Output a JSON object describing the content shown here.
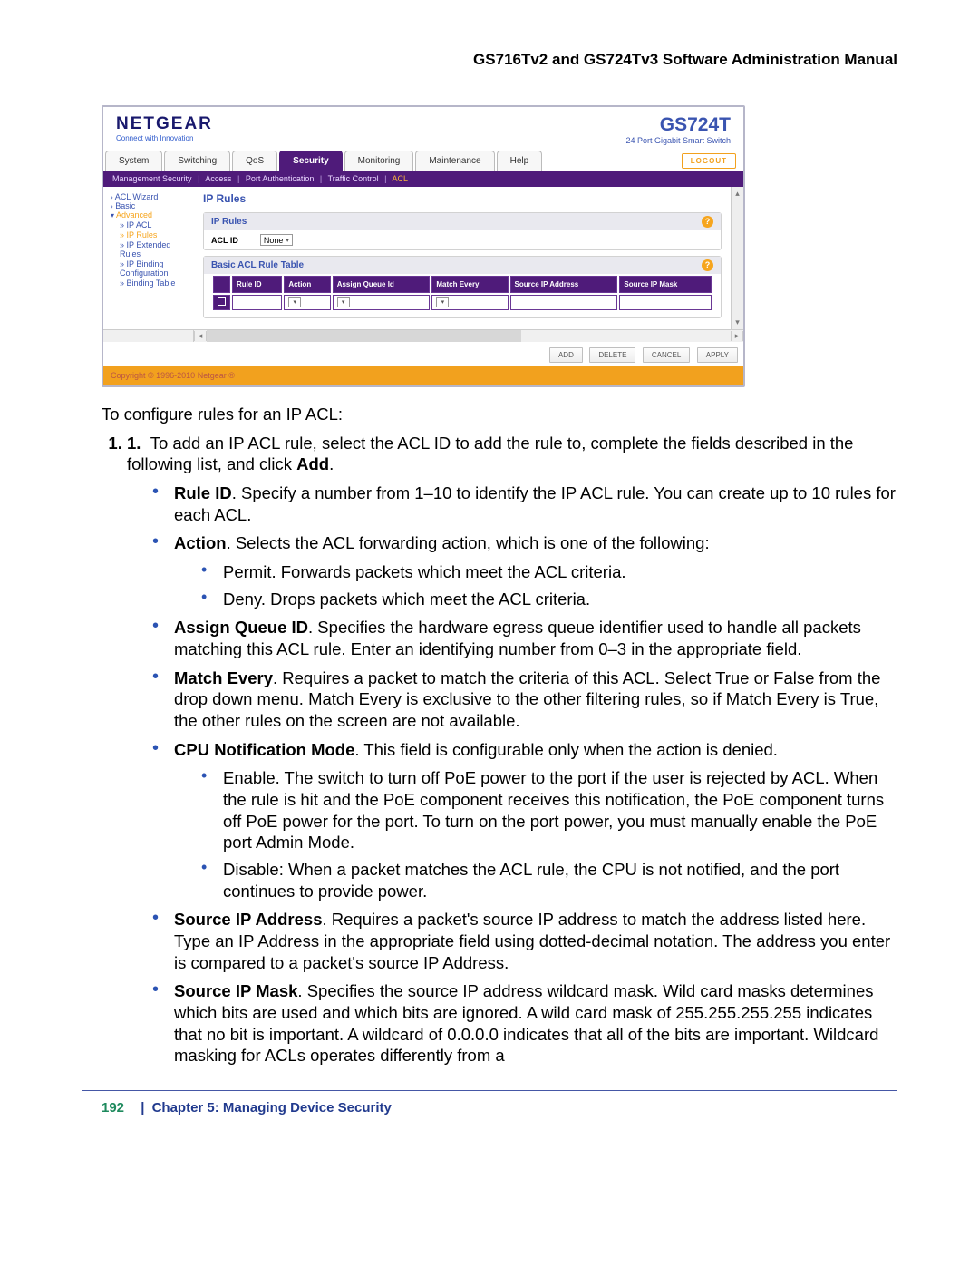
{
  "doc_title": "GS716Tv2 and GS724Tv3 Software Administration Manual",
  "screenshot": {
    "brand": "NETGEAR",
    "brand_tag": "Connect with Innovation",
    "product": "GS724T",
    "product_sub": "24 Port Gigabit Smart Switch",
    "logout": "LOGOUT",
    "tabs": [
      "System",
      "Switching",
      "QoS",
      "Security",
      "Monitoring",
      "Maintenance",
      "Help"
    ],
    "active_tab_index": 3,
    "subnav": {
      "items": [
        "Management Security",
        "Access",
        "Port Authentication",
        "Traffic Control",
        "ACL"
      ],
      "active_index": 4
    },
    "leftnav": {
      "items": [
        {
          "label": "ACL Wizard",
          "type": "top"
        },
        {
          "label": "Basic",
          "type": "top"
        },
        {
          "label": "Advanced",
          "type": "top",
          "class": "adv"
        },
        {
          "label": "IP ACL",
          "type": "sub"
        },
        {
          "label": "IP Rules",
          "type": "sub",
          "active": true
        },
        {
          "label": "IP Extended Rules",
          "type": "sub"
        },
        {
          "label": "IP Binding Configuration",
          "type": "sub"
        },
        {
          "label": "Binding Table",
          "type": "sub"
        }
      ]
    },
    "page_title": "IP Rules",
    "box1_title": "IP Rules",
    "acl_id_label": "ACL ID",
    "acl_id_value": "None",
    "box2_title": "Basic ACL Rule Table",
    "columns": [
      "Rule ID",
      "Action",
      "Assign Queue Id",
      "Match Every",
      "Source IP Address",
      "Source IP Mask"
    ],
    "buttons": [
      "ADD",
      "DELETE",
      "CANCEL",
      "APPLY"
    ],
    "copyright": "Copyright © 1996-2010 Netgear ®"
  },
  "body": {
    "intro": "To configure rules for an IP ACL:",
    "step1_a": "To add an IP ACL rule, select the ACL ID to add the rule to, complete the fields described in the following list, and click ",
    "step1_b": "Add",
    "step1_c": ".",
    "items": [
      {
        "head": "Rule ID",
        "text": ". Specify a number from 1–10 to identify the IP ACL rule. You can create up to 10 rules for each ACL."
      },
      {
        "head": "Action",
        "text": ". Selects the ACL forwarding action, which is one of the following:",
        "sub": [
          "Permit. Forwards packets which meet the ACL criteria.",
          "Deny. Drops packets which meet the ACL criteria."
        ]
      },
      {
        "head": "Assign Queue ID",
        "text": ". Specifies the hardware egress queue identifier used to handle all packets matching this ACL rule. Enter an identifying number from 0–3 in the appropriate field."
      },
      {
        "head": "Match Every",
        "text": ". Requires a packet to match the criteria of this ACL. Select True or False from the drop down menu. Match Every is exclusive to the other filtering rules, so if Match Every is True, the other rules on the screen are not available."
      },
      {
        "head": "CPU Notification Mode",
        "text": ". This field is configurable only when the action is denied.",
        "sub": [
          "Enable. The switch to turn off PoE power to the port if the user is rejected by ACL. When the rule is hit and the PoE component receives this notification, the PoE component turns off PoE power for the port. To turn on the port power, you must manually enable the PoE port Admin Mode.",
          "Disable: When a packet matches the ACL rule, the CPU is not notified, and the port continues to provide power."
        ]
      },
      {
        "head": "Source IP Address",
        "text": ". Requires a packet's source IP address to match the address listed here. Type an IP Address in the appropriate field using dotted-decimal notation. The address you enter is compared to a packet's source IP Address."
      },
      {
        "head": "Source IP Mask",
        "text": ". Specifies the source IP address wildcard mask. Wild card masks determines which bits are used and which bits are ignored. A wild card mask of 255.255.255.255 indicates that no bit is important. A wildcard of 0.0.0.0 indicates that all of the bits are important. Wildcard masking for ACLs operates differently from a"
      }
    ]
  },
  "footer": {
    "page": "192",
    "chapter": "Chapter 5:  Managing Device Security"
  }
}
